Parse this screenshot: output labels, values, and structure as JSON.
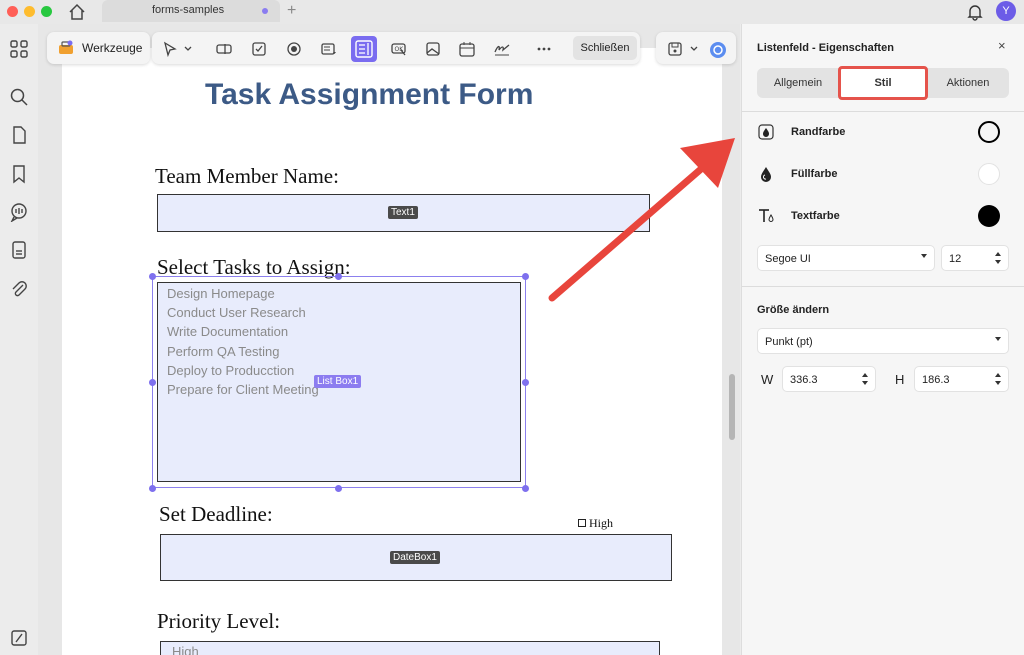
{
  "titlebar": {
    "tab_label": "forms-samples",
    "tab_add": "+",
    "avatar_initial": "Y"
  },
  "toolbar": {
    "tools_label": "Werkzeuge",
    "close_label": "Schließen",
    "accent_color": "#7a6cf0"
  },
  "document": {
    "title": "Task Assignment Form",
    "team_member_label": "Team Member Name:",
    "text1_tag": "Text1",
    "select_tasks_label": "Select Tasks to Assign:",
    "listbox_tag": "List Box1",
    "listbox_items": [
      "Design Homepage",
      "Conduct User Research",
      "Write Documentation",
      "Perform QA Testing",
      "Deploy to Producction",
      "Prepare for Client Meeting"
    ],
    "deadline_label": "Set Deadline:",
    "datebox_tag": "DateBox1",
    "high_checkbox_label": "High",
    "priority_label": "Priority Level:",
    "priority_value": "High"
  },
  "panel": {
    "title": "Listenfeld - Eigenschaften",
    "close": "×",
    "tabs": [
      {
        "label": "Allgemein",
        "active": false
      },
      {
        "label": "Stil",
        "active": true
      },
      {
        "label": "Aktionen",
        "active": false
      }
    ],
    "border_color_label": "Randfarbe",
    "fill_color_label": "Füllfarbe",
    "text_color_label": "Textfarbe",
    "border_color": "#000000",
    "fill_color": "#ffffff",
    "text_color": "#000000",
    "font_family": "Segoe UI",
    "font_size": "12",
    "resize_label": "Größe ändern",
    "unit": "Punkt (pt)",
    "width_label": "W",
    "width_value": "336.3",
    "height_label": "H",
    "height_value": "186.3"
  }
}
